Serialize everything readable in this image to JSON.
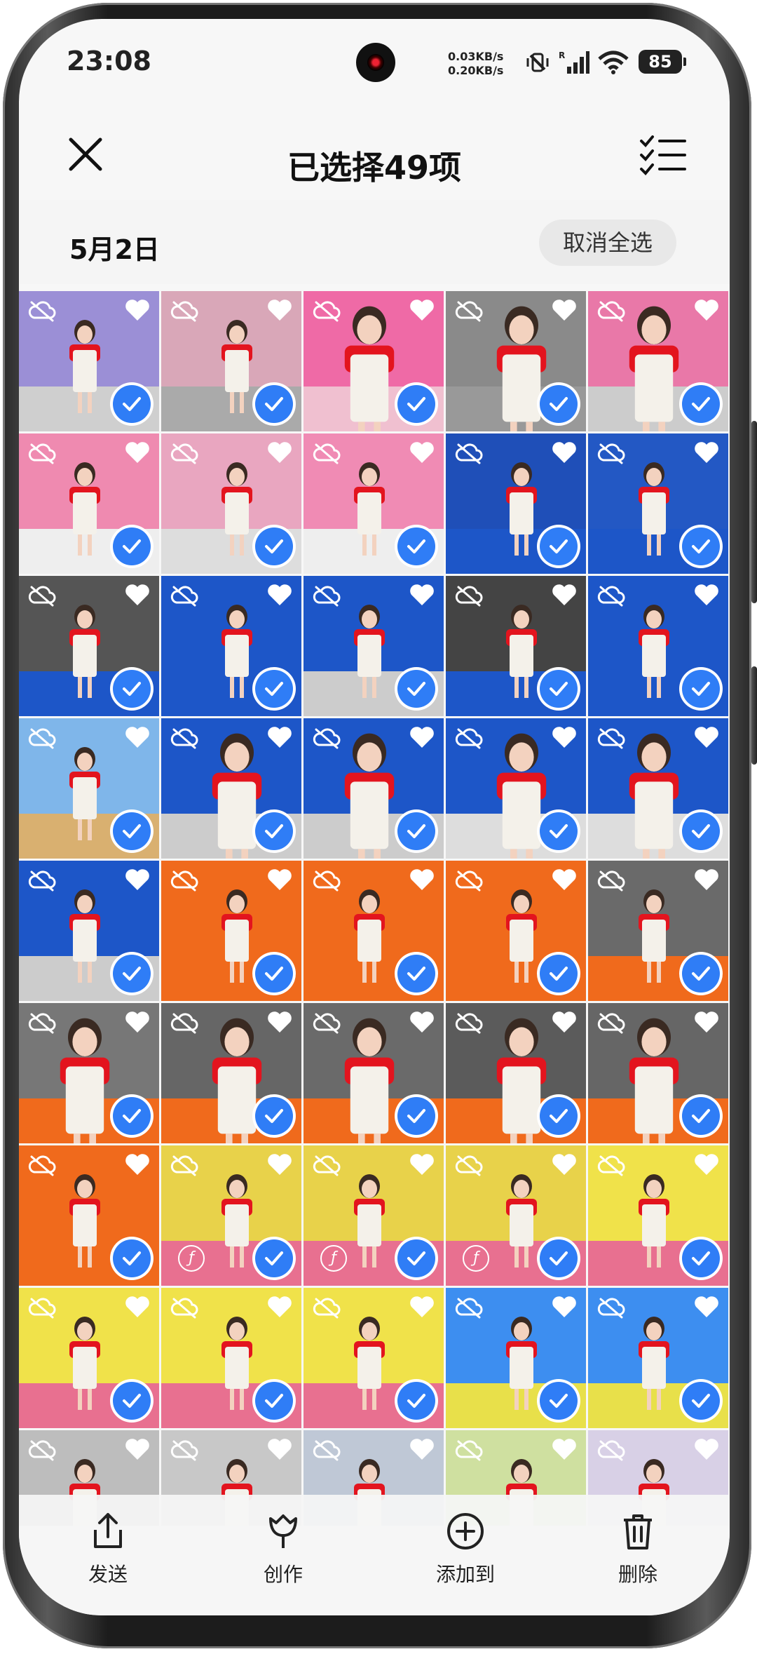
{
  "status_bar": {
    "time": "23:08",
    "upload_speed": "0.03KB/s",
    "download_speed": "0.20KB/s",
    "battery": "85"
  },
  "header": {
    "title": "已选择49项",
    "close_icon": "close-icon",
    "select_mode_icon": "checklist-icon"
  },
  "section": {
    "date": "5月2日",
    "deselect_all_label": "取消全选"
  },
  "grid": {
    "columns": 5,
    "tile_icons": [
      "cloud-off-icon",
      "heart-icon",
      "check-circle-icon"
    ],
    "accent_color": "#2f7df6"
  },
  "toolbar": {
    "items": [
      {
        "label": "发送",
        "icon": "share-icon"
      },
      {
        "label": "创作",
        "icon": "tulip-icon"
      },
      {
        "label": "添加到",
        "icon": "plus-circle-icon"
      },
      {
        "label": "删除",
        "icon": "trash-icon"
      }
    ]
  }
}
